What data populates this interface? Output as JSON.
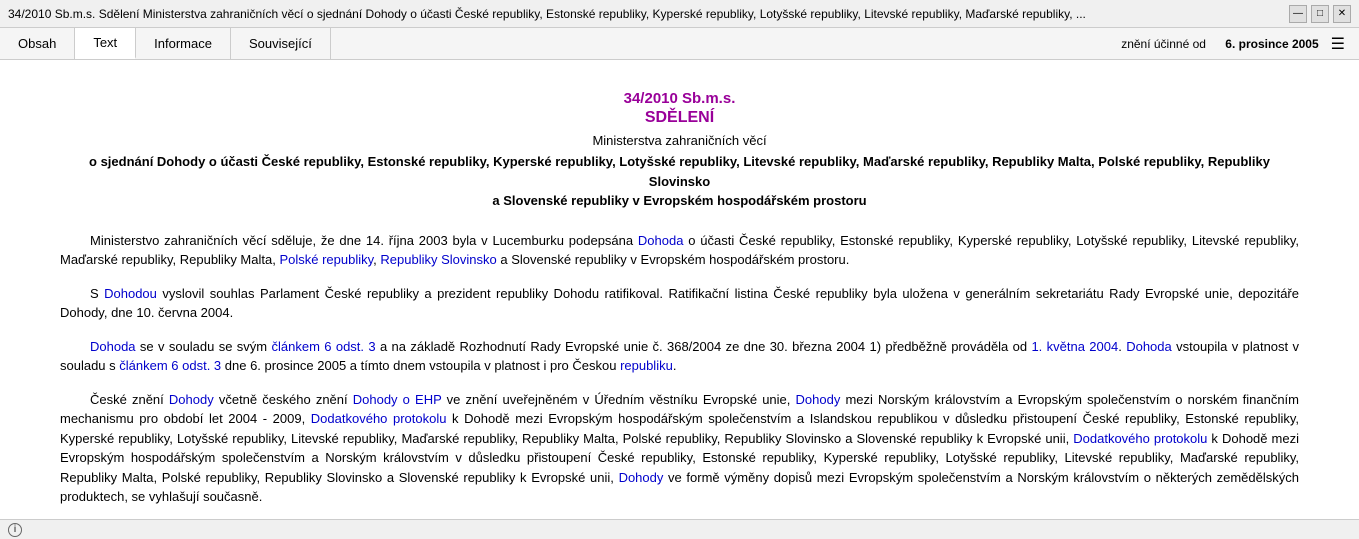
{
  "titlebar": {
    "text": "34/2010 Sb.m.s. Sdělení Ministerstva zahraničních věcí o sjednání Dohody o účasti České republiky, Estonské republiky, Kyperské republiky, Lotyšské republiky, Litevské republiky, Maďarské republiky, ...",
    "minimize": "—",
    "maximize": "□",
    "close": "✕"
  },
  "tabs": {
    "items": [
      {
        "label": "Obsah",
        "active": false
      },
      {
        "label": "Text",
        "active": true
      },
      {
        "label": "Informace",
        "active": false
      },
      {
        "label": "Související",
        "active": false
      }
    ],
    "status_label": "znění účinné od",
    "status_date": "6. prosince 2005"
  },
  "document": {
    "title": "34/2010 Sb.m.s.",
    "subtitle": "SDĚLENÍ",
    "ministry": "Ministerstva zahraničních věcí",
    "subject": "o sjednání Dohody o účasti České republiky, Estonské republiky, Kyperské republiky, Lotyšské republiky, Litevské republiky, Maďarské republiky, Republiky Malta, Polské republiky, Republiky Slovinsko\na Slovenské republiky v Evropském hospodářském prostoru",
    "paragraphs": [
      {
        "id": "p1",
        "indent": true,
        "html": "Ministerstvo zahraničních věcí sděluje, že dne 14. října 2003 byla v Lucemburku podepsána <a class=\"link\">Dohoda</a> o účasti České republiky, Estonské republiky, Kyperské republiky, Lotyšské republiky, Litevské republiky, Maďarské republiky, Republiky Malta, <a class=\"link\">Polské republiky</a>, <a class=\"link\">Republiky Slovinsko</a> a Slovenské republiky v Evropském hospodářském prostoru."
      },
      {
        "id": "p2",
        "indent": true,
        "html": "S <a class=\"link\">Dohodou</a> vyslovil souhlas Parlament České republiky a prezident republiky Dohodu ratifikoval. Ratifikační listina České republiky byla uložena v generálním sekretariátu Rady Evropské unie, depozitáře Dohody, dne 10. června 2004."
      },
      {
        "id": "p3",
        "indent": true,
        "html": "<a class=\"link\">Dohoda</a> se v souladu se svým <a class=\"link\">článkem 6 odst. 3</a> a na základě Rozhodnutí Rady Evropské unie č. 368/2004 ze dne 30. března 2004 1) předběžně prováděla od <a class=\"link\">1. května 2004</a>. <a class=\"link\">Dohoda</a> vstoupila v platnost v souladu s <a class=\"link\">článkem 6 odst. 3</a> dne 6. prosince 2005 a tímto dnem vstoupila v platnost i pro Českou <a class=\"link\">republiku</a>."
      },
      {
        "id": "p4",
        "indent": true,
        "html": "České znění <a class=\"link\">Dohody</a> včetně českého znění <a class=\"link\">Dohody o EHP</a> ve znění uveřejněném v Úředním věstníku Evropské unie, <a class=\"link\">Dohody</a> mezi Norským královstvím a Evropským společenstvím o norském finančním mechanismu pro období let 2004 - 2009, <a class=\"link\">Dodatkového protokolu</a> k Dohodě mezi Evropským hospodářským společenstvím a Islandskou republikou v důsledku přistoupení České republiky, Estonské republiky, Kyperské republiky, Lotyšské republiky, Litevské republiky, Maďarské republiky, Republiky Malta, Polské republiky, Republiky Slovinsko a Slovenské republiky k Evropské unii, <a class=\"link\">Dodatkového protokolu</a> k Dohodě mezi Evropským hospodářským společenstvím a Norským královstvím v důsledku přistoupení České republiky, Estonské republiky, Kyperské republiky, Lotyšské republiky, Litevské republiky, Maďarské republiky, Republiky Malta, Polské republiky, Republiky Slovinsko a Slovenské republiky k Evropské unii, <a class=\"link\">Dohody</a> ve formě výměny dopisů mezi Evropským společenstvím a Norským královstvím o některých zemědělských produktech, se vyhlašují současně."
      }
    ]
  },
  "bottombar": {
    "info": "ⓘ"
  }
}
